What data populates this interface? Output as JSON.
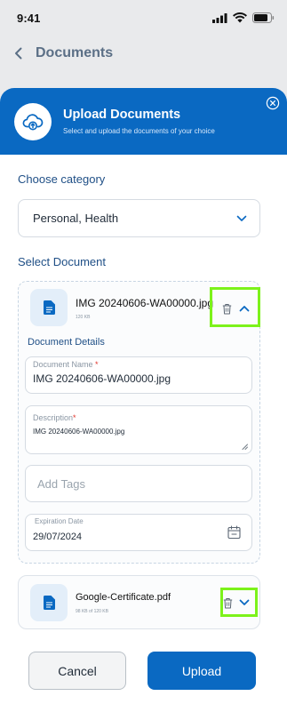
{
  "status_bar": {
    "time": "9:41"
  },
  "nav": {
    "title": "Documents"
  },
  "sheet": {
    "title": "Upload Documents",
    "subtitle": "Select and upload the documents of your choice"
  },
  "category": {
    "label": "Choose category",
    "value": "Personal, Health"
  },
  "select_document": {
    "label": "Select Document"
  },
  "file1": {
    "name": "IMG 20240606-WA00000.jpg",
    "size": "120 KB",
    "details_title": "Document Details",
    "document_name_label": "Document Name",
    "document_name_value": "IMG 20240606-WA00000.jpg",
    "description_label": "Description",
    "description_value": "IMG 20240606-WA00000.jpg",
    "tags_placeholder": "Add Tags",
    "expiration_label": "Expiration Date",
    "expiration_value": "29/07/2024"
  },
  "file2": {
    "name": "Google-Certificate.pdf",
    "size": "98 KB of 120 KB"
  },
  "buttons": {
    "cancel": "Cancel",
    "upload": "Upload"
  },
  "colors": {
    "primary": "#0a69c2",
    "highlight": "#7cf21a",
    "required": "#e0342b"
  }
}
